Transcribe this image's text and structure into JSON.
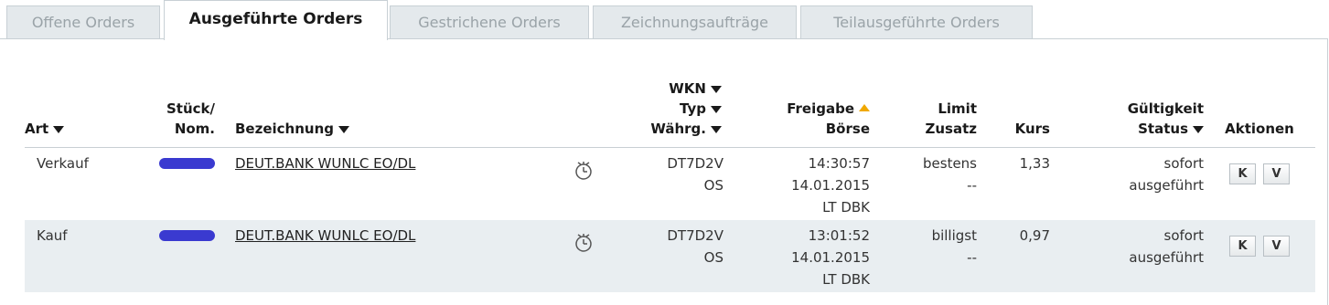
{
  "tabs": [
    {
      "label": "Offene Orders",
      "active": false
    },
    {
      "label": "Ausgeführte Orders",
      "active": true
    },
    {
      "label": "Gestrichene Orders",
      "active": false
    },
    {
      "label": "Zeichnungsaufträge",
      "active": false
    },
    {
      "label": "Teilausgeführte Orders",
      "active": false
    }
  ],
  "columns": {
    "art": "Art",
    "stueck_line1": "Stück/",
    "stueck_line2": "Nom.",
    "bezeichnung": "Bezeichnung",
    "wkn": "WKN",
    "typ": "Typ",
    "waehrg": "Währg.",
    "freigabe": "Freigabe",
    "boerse": "Börse",
    "limit": "Limit",
    "zusatz": "Zusatz",
    "kurs": "Kurs",
    "gueltigkeit": "Gültigkeit",
    "status": "Status",
    "aktionen": "Aktionen"
  },
  "rows": [
    {
      "art": "Verkauf",
      "bezeichnung": "DEUT.BANK WUNLC EO/DL",
      "wkn": "DT7D2V",
      "typ": "OS",
      "time": "14:30:57",
      "date": "14.01.2015",
      "boerse": "LT DBK",
      "limit": "bestens",
      "zusatz": "--",
      "kurs": "1,33",
      "gueltigkeit": "sofort",
      "status": "ausgeführt",
      "btn_k": "K",
      "btn_v": "V"
    },
    {
      "art": "Kauf",
      "bezeichnung": "DEUT.BANK WUNLC EO/DL",
      "wkn": "DT7D2V",
      "typ": "OS",
      "time": "13:01:52",
      "date": "14.01.2015",
      "boerse": "LT DBK",
      "limit": "billigst",
      "zusatz": "--",
      "kurs": "0,97",
      "gueltigkeit": "sofort",
      "status": "ausgeführt",
      "btn_k": "K",
      "btn_v": "V"
    }
  ],
  "colors": {
    "redaction": "#3a3ad0",
    "sort_active": "#f0a800",
    "row_alt": "#e9eef1"
  },
  "icons": {
    "sort_desc": "triangle-down",
    "sort_asc": "triangle-up",
    "timer": "stopwatch-icon"
  }
}
